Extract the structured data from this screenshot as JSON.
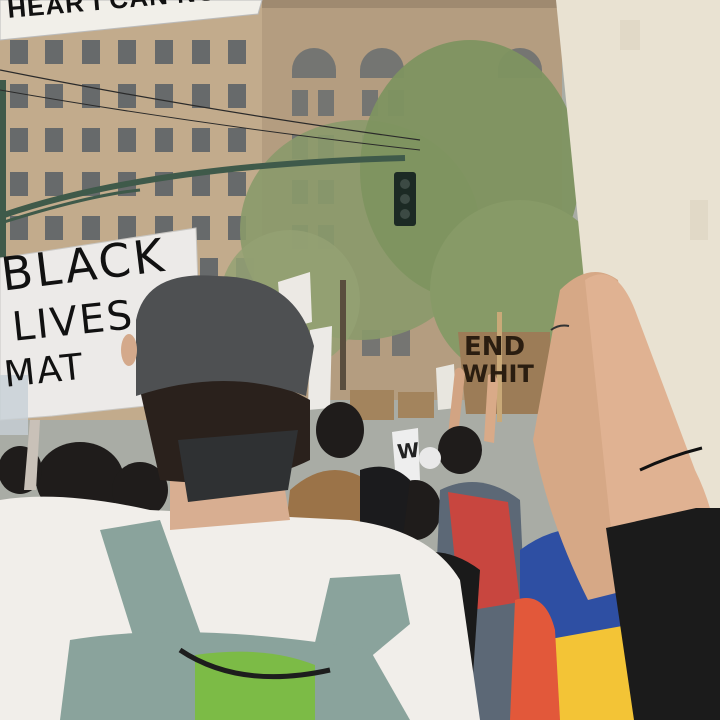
{
  "signs": {
    "banner": "HEAR I CAN NO",
    "black_lives": [
      "BLACK",
      "LIVES",
      "MAT"
    ],
    "end_white": [
      "END",
      "WHIT"
    ],
    "small_right": "W"
  },
  "colors": {
    "sky": "#a9aca5",
    "building_left": "#c2ab8c",
    "building_right": "#b49d80",
    "trees": "#8a9a6a",
    "sign_card": "#e9e2d2",
    "cardboard": "#9c7c57",
    "cap": "#4e5052",
    "shirt_white": "#f1eeea",
    "backpack": "#8aa39c",
    "backpack_zip": "#7cbb46",
    "jacket_blue": "#2e4fa3",
    "jacket_yellow": "#f3c436",
    "jacket_red": "#e2583a",
    "red_backpack": "#c8463f"
  },
  "icons": [
    "traffic-light-icon",
    "street-lamp-arm-icon"
  ]
}
